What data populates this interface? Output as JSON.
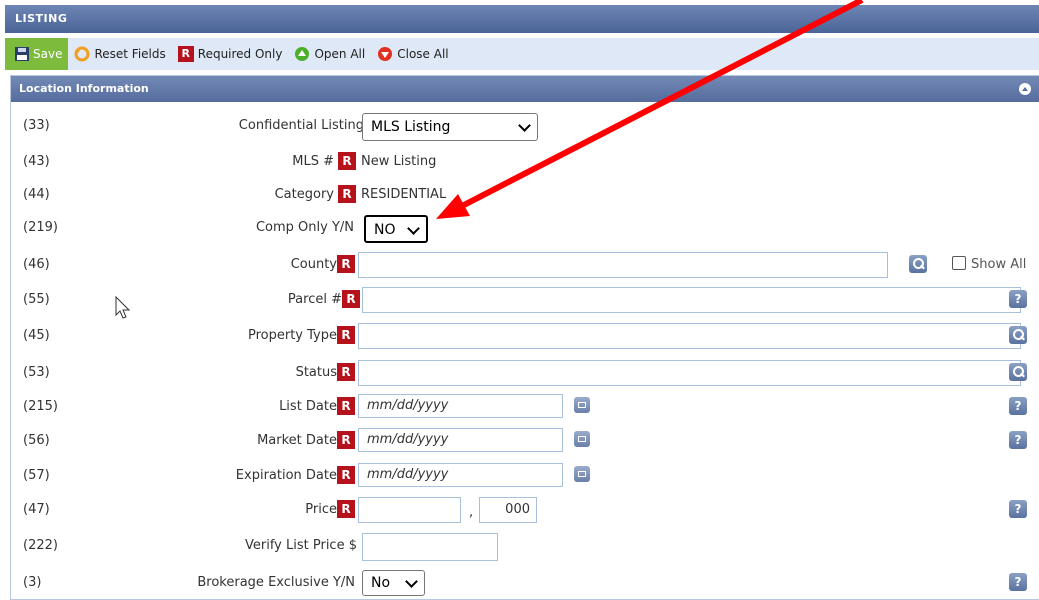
{
  "window": {
    "title": "LISTING"
  },
  "toolbar": {
    "save_label": "Save",
    "reset_label": "Reset Fields",
    "required_label": "Required Only",
    "open_all_label": "Open All",
    "close_all_label": "Close All",
    "required_badge": "R"
  },
  "section": {
    "title": "Location Information"
  },
  "rows": {
    "confidential": {
      "num": "(33)",
      "label": "Confidential Listing",
      "value": "MLS Listing"
    },
    "mls": {
      "num": "(43)",
      "label": "MLS #",
      "value": "New Listing",
      "badge": "R"
    },
    "category": {
      "num": "(44)",
      "label": "Category",
      "value": "RESIDENTIAL",
      "badge": "R"
    },
    "comp_only": {
      "num": "(219)",
      "label": "Comp Only Y/N",
      "value": "NO"
    },
    "county": {
      "num": "(46)",
      "label": "County",
      "badge": "R",
      "show_all_label": "Show All"
    },
    "parcel": {
      "num": "(55)",
      "label": "Parcel #",
      "badge": "R",
      "help": "?"
    },
    "property_type": {
      "num": "(45)",
      "label": "Property Type",
      "badge": "R"
    },
    "status": {
      "num": "(53)",
      "label": "Status",
      "badge": "R"
    },
    "list_date": {
      "num": "(215)",
      "label": "List Date",
      "badge": "R",
      "placeholder": "mm/dd/yyyy",
      "help": "?"
    },
    "market_date": {
      "num": "(56)",
      "label": "Market Date",
      "badge": "R",
      "placeholder": "mm/dd/yyyy",
      "help": "?"
    },
    "expiration_date": {
      "num": "(57)",
      "label": "Expiration Date",
      "badge": "R",
      "placeholder": "mm/dd/yyyy"
    },
    "price": {
      "num": "(47)",
      "label": "Price",
      "badge": "R",
      "separator": ",",
      "thousands": "000",
      "help": "?"
    },
    "verify_price": {
      "num": "(222)",
      "label": "Verify List Price $"
    },
    "brokerage": {
      "num": "(3)",
      "label": "Brokerage Exclusive Y/N",
      "value": "No",
      "help": "?"
    }
  },
  "colors": {
    "required_red": "#b5121b",
    "header_blue": "#556c9d",
    "save_green": "#7dbb3d",
    "annotation_arrow": "#ff0000"
  }
}
